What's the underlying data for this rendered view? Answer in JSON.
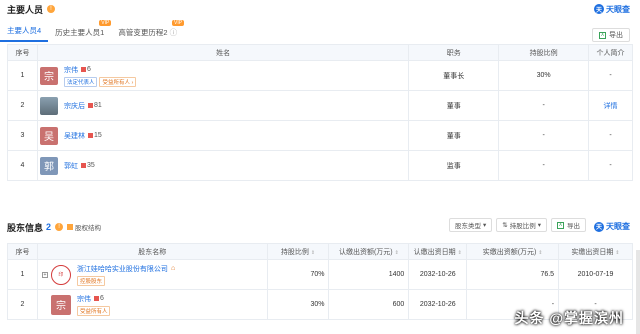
{
  "main_section": {
    "title": "主要人员",
    "brand": "天眼查",
    "tabs": [
      {
        "label": "主要人员4",
        "active": true,
        "vip": false
      },
      {
        "label": "历史主要人员1",
        "active": false,
        "vip": true
      },
      {
        "label": "高管变更历程2",
        "active": false,
        "vip": true
      }
    ],
    "vip_label": "VIP",
    "export_label": "导出",
    "headers": [
      "序号",
      "姓名",
      "职务",
      "持股比例",
      "个人简介"
    ],
    "rows": [
      {
        "index": "1",
        "avatar": "宗",
        "avatar_color": "#c9716f",
        "name": "宗伟",
        "count": "6",
        "tags": [
          "法定代表人",
          "受益所有人 ›"
        ],
        "role": "董事长",
        "ratio": "30%",
        "profile": "-"
      },
      {
        "index": "2",
        "avatar": "",
        "avatar_color": "#7a8a96",
        "name": "宗庆后",
        "count": "81",
        "tags": [],
        "role": "董事",
        "ratio": "-",
        "profile": "详情"
      },
      {
        "index": "3",
        "avatar": "吴",
        "avatar_color": "#c9716f",
        "name": "吴建林",
        "count": "15",
        "tags": [],
        "role": "董事",
        "ratio": "-",
        "profile": "-"
      },
      {
        "index": "4",
        "avatar": "郭",
        "avatar_color": "#7f97b8",
        "name": "郭虹",
        "count": "35",
        "tags": [],
        "role": "监事",
        "ratio": "-",
        "profile": "-"
      }
    ]
  },
  "shareholder_section": {
    "title": "股东信息",
    "count": "2",
    "structure_label": "股权结构",
    "filters": [
      "股东类型",
      "持股比例",
      "导出"
    ],
    "headers": [
      "序号",
      "股东名称",
      "持股比例",
      "认缴出资额(万元)",
      "认缴出资日期",
      "实缴出资额(万元)",
      "实缴出资日期"
    ],
    "rows": [
      {
        "index": "1",
        "name": "浙江娃哈哈实业股份有限公司",
        "tag": "控股股东",
        "ratio": "70%",
        "subscribed": "1400",
        "sub_date": "2032-10-26",
        "paid": "76.5",
        "paid_date": "2010-07-19"
      },
      {
        "index": "2",
        "name": "宗伟",
        "count": "6",
        "avatar": "宗",
        "tag": "受益所有人",
        "ratio": "30%",
        "subscribed": "600",
        "sub_date": "2032-10-26",
        "paid": "-",
        "paid_date": "-"
      }
    ]
  },
  "watermark": "头条 @掌握滨州"
}
